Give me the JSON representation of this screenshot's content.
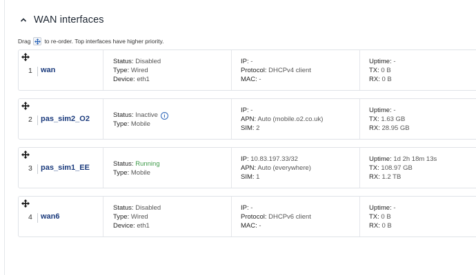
{
  "section": {
    "title": "WAN interfaces"
  },
  "hint": {
    "before": "Drag",
    "after": "to re-order. Top interfaces have higher priority."
  },
  "labels": {
    "status": "Status:",
    "type": "Type:",
    "device": "Device:",
    "ip": "IP:",
    "protocol": "Protocol:",
    "mac": "MAC:",
    "apn": "APN:",
    "sim": "SIM:",
    "uptime": "Uptime:",
    "tx": "TX:",
    "rx": "RX:"
  },
  "interfaces": [
    {
      "num": "1",
      "name": "wan",
      "status": "Disabled",
      "type": "Wired",
      "device": "eth1",
      "ip": "-",
      "protocol": "DHCPv4 client",
      "mac": "-",
      "uptime": "-",
      "tx": "0 B",
      "rx": "0 B"
    },
    {
      "num": "2",
      "name": "pas_sim2_O2",
      "status": "Inactive",
      "type": "Mobile",
      "ip": "-",
      "apn": "Auto (mobile.o2.co.uk)",
      "sim": "2",
      "uptime": "-",
      "tx": "1.63 GB",
      "rx": "28.95 GB"
    },
    {
      "num": "3",
      "name": "pas_sim1_EE",
      "status": "Running",
      "type": "Mobile",
      "ip": "10.83.197.33/32",
      "apn": "Auto (everywhere)",
      "sim": "1",
      "uptime": "1d 2h 18m 13s",
      "tx": "108.97 GB",
      "rx": "1.2 TB"
    },
    {
      "num": "4",
      "name": "wan6",
      "status": "Disabled",
      "type": "Wired",
      "device": "eth1",
      "ip": "-",
      "protocol": "DHCPv6 client",
      "mac": "-",
      "uptime": "-",
      "tx": "0 B",
      "rx": "0 B"
    }
  ],
  "colors": {
    "link": "#1a3a7c",
    "running": "#3d9a48",
    "info": "#2a64b8",
    "border": "#dfe2e7"
  },
  "icons": {
    "collapse": "chevron-up-icon",
    "drag": "move-arrows-icon",
    "info": "info-icon"
  }
}
